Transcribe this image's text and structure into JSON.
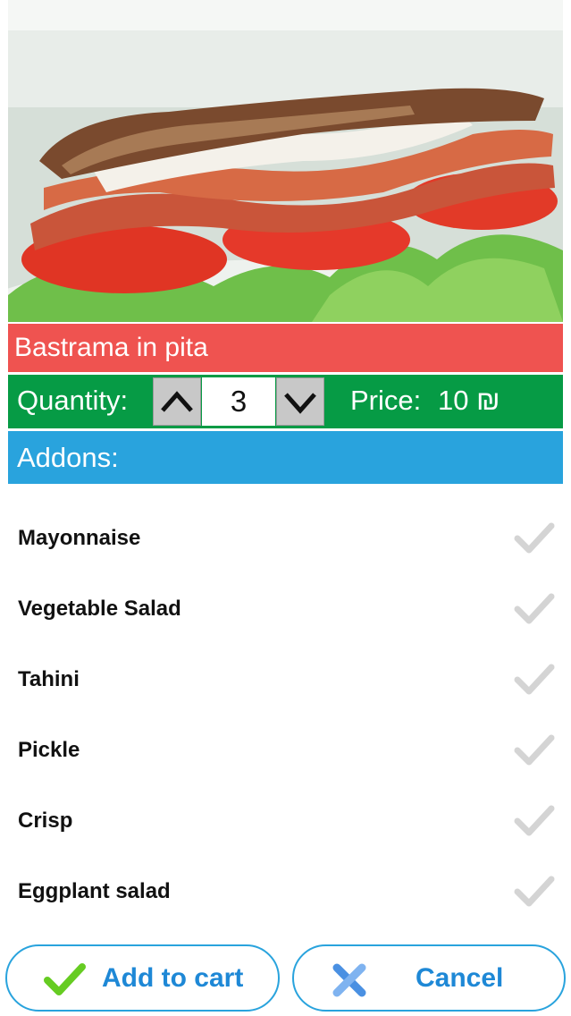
{
  "product": {
    "title": "Bastrama in pita",
    "image_icon": "sandwich-photo"
  },
  "quantity": {
    "label": "Quantity:",
    "value": "3",
    "up_icon": "chevron-up-icon",
    "down_icon": "chevron-down-icon"
  },
  "price": {
    "label": "Price:",
    "value": "10 ₪"
  },
  "addons": {
    "header": "Addons:",
    "items": [
      {
        "label": "Mayonnaise",
        "checked": false
      },
      {
        "label": "Vegetable Salad",
        "checked": false
      },
      {
        "label": "Tahini",
        "checked": false
      },
      {
        "label": "Pickle",
        "checked": false
      },
      {
        "label": "Crisp",
        "checked": false
      },
      {
        "label": "Eggplant salad",
        "checked": false
      }
    ]
  },
  "actions": {
    "add_label": "Add to cart",
    "cancel_label": "Cancel"
  },
  "colors": {
    "title_bar": "#ef5350",
    "quantity_bar": "#069b45",
    "addons_bar": "#29a3dd",
    "button_text": "#1e88d6",
    "check_unselected": "#d4d4d4",
    "add_icon": "#66cc22",
    "cancel_icon": "#4a90e2"
  }
}
